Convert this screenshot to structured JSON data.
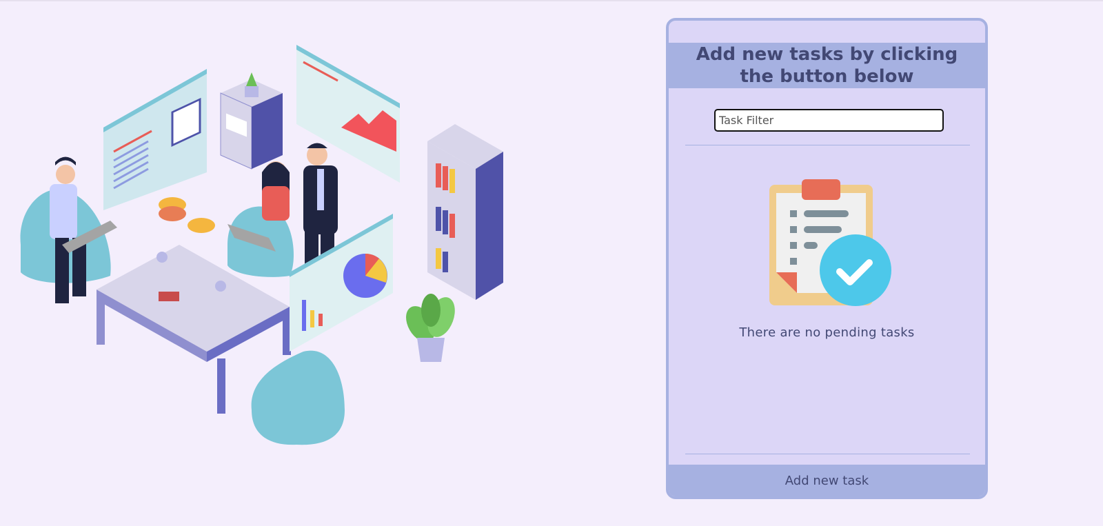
{
  "task_panel": {
    "title": "Add new tasks by clicking the button below",
    "filter": {
      "placeholder": "Task Filter",
      "value": ""
    },
    "empty_state": {
      "icon": "clipboard-check-icon",
      "text": "There are no pending tasks"
    },
    "add_button_label": "Add new task"
  },
  "colors": {
    "background": "#f4eefc",
    "panel": "#dcd6f7",
    "accent": "#a6b1e1",
    "text": "#424874",
    "check_circle": "#4dc8ea",
    "clip": "#e76d57"
  }
}
